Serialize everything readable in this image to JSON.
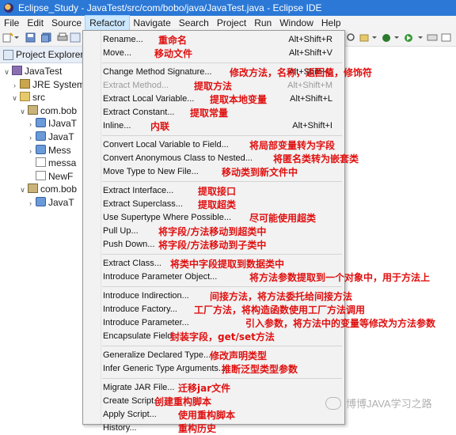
{
  "window": {
    "title": "Eclipse_Study - JavaTest/src/com/bobo/java/JavaTest.java - Eclipse IDE"
  },
  "menubar": [
    "File",
    "Edit",
    "Source",
    "Refactor",
    "Navigate",
    "Search",
    "Project",
    "Run",
    "Window",
    "Help"
  ],
  "explorer": {
    "title": "Project Explorer",
    "rows": [
      {
        "twisty": "∨",
        "icon": "project",
        "label": "JavaTest"
      },
      {
        "twisty": "›",
        "icon": "lib",
        "label": "JRE System"
      },
      {
        "twisty": "∨",
        "icon": "folder",
        "label": "src"
      },
      {
        "twisty": "∨",
        "icon": "pkg",
        "label": "com.bob"
      },
      {
        "twisty": "›",
        "icon": "java",
        "label": "IJavaT"
      },
      {
        "twisty": "›",
        "icon": "java",
        "label": "JavaT"
      },
      {
        "twisty": "›",
        "icon": "java",
        "label": "Mess"
      },
      {
        "twisty": "",
        "icon": "file",
        "label": "messa"
      },
      {
        "twisty": "",
        "icon": "file",
        "label": "NewF"
      },
      {
        "twisty": "∨",
        "icon": "pkg",
        "label": "com.bob"
      },
      {
        "twisty": "›",
        "icon": "java",
        "label": "JavaT"
      }
    ]
  },
  "refactor_menu": [
    {
      "label": "Rename...",
      "accel": "Alt+Shift+R",
      "note": "重命名",
      "enabled": true
    },
    {
      "label": "Move...",
      "accel": "Alt+Shift+V",
      "note": "移动文件",
      "enabled": true
    },
    {
      "sep": true
    },
    {
      "label": "Change Method Signature...",
      "accel": "Alt+Shift+C",
      "note": "修改方法，名称，返回值，修饰符",
      "enabled": true
    },
    {
      "label": "Extract Method...",
      "accel": "Alt+Shift+M",
      "note": "提取方法",
      "enabled": false
    },
    {
      "label": "Extract Local Variable...",
      "accel": "Alt+Shift+L",
      "note": "提取本地变量",
      "enabled": true
    },
    {
      "label": "Extract Constant...",
      "accel": "",
      "note": "提取常量",
      "enabled": true
    },
    {
      "label": "Inline...",
      "accel": "Alt+Shift+I",
      "note": "内联",
      "enabled": true
    },
    {
      "sep": true
    },
    {
      "label": "Convert Local Variable to Field...",
      "accel": "",
      "note": "将局部变量转为字段",
      "enabled": true
    },
    {
      "label": "Convert Anonymous Class to Nested...",
      "accel": "",
      "note": "将匿名类转为嵌套类",
      "enabled": true
    },
    {
      "label": "Move Type to New File...",
      "accel": "",
      "note": "移动类到新文件中",
      "enabled": true
    },
    {
      "sep": true
    },
    {
      "label": "Extract Interface...",
      "accel": "",
      "note": "提取接口",
      "enabled": true
    },
    {
      "label": "Extract Superclass...",
      "accel": "",
      "note": "提取超类",
      "enabled": true
    },
    {
      "label": "Use Supertype Where Possible...",
      "accel": "",
      "note": "尽可能使用超类",
      "enabled": true
    },
    {
      "label": "Pull Up...",
      "accel": "",
      "note": "将字段/方法移动到超类中",
      "enabled": true
    },
    {
      "label": "Push Down...",
      "accel": "",
      "note": "将字段/方法移动到子类中",
      "enabled": true
    },
    {
      "sep": true
    },
    {
      "label": "Extract Class...",
      "accel": "",
      "note": "将类中字段提取到数据类中",
      "enabled": true
    },
    {
      "label": "Introduce Parameter Object...",
      "accel": "",
      "note": "将方法参数提取到一个对象中，用于方法上",
      "enabled": true
    },
    {
      "sep": true
    },
    {
      "label": "Introduce Indirection...",
      "accel": "",
      "note": "间接方法，将方法委托给间接方法",
      "enabled": true
    },
    {
      "label": "Introduce Factory...",
      "accel": "",
      "note": "工厂方法，将构造函数使用工厂方法调用",
      "enabled": true
    },
    {
      "label": "Introduce Parameter...",
      "accel": "",
      "note": "引入参数，将方法中的变量等修改为方法参数",
      "enabled": true
    },
    {
      "label": "Encapsulate Field...",
      "accel": "",
      "note": "封装字段，get/set方法",
      "enabled": true
    },
    {
      "sep": true
    },
    {
      "label": "Generalize Declared Type...",
      "accel": "",
      "note": "修改声明类型",
      "enabled": true
    },
    {
      "label": "Infer Generic Type Arguments...",
      "accel": "",
      "note": "推断泛型类型参数",
      "enabled": true
    },
    {
      "sep": true
    },
    {
      "label": "Migrate JAR File...",
      "accel": "",
      "note": "迁移jar文件",
      "enabled": true
    },
    {
      "label": "Create Script...",
      "accel": "",
      "note": "创建重构脚本",
      "enabled": true
    },
    {
      "label": "Apply Script...",
      "accel": "",
      "note": "使用重构脚本",
      "enabled": true
    },
    {
      "label": "History...",
      "accel": "",
      "note": "重构历史",
      "enabled": true
    }
  ],
  "watermark": {
    "text": "博博JAVA学习之路"
  },
  "colors": {
    "titlebar": "#2b78d6",
    "note": "#e01010",
    "menu_bg": "#f2f2f2",
    "active_menu": "#cce8ff"
  }
}
